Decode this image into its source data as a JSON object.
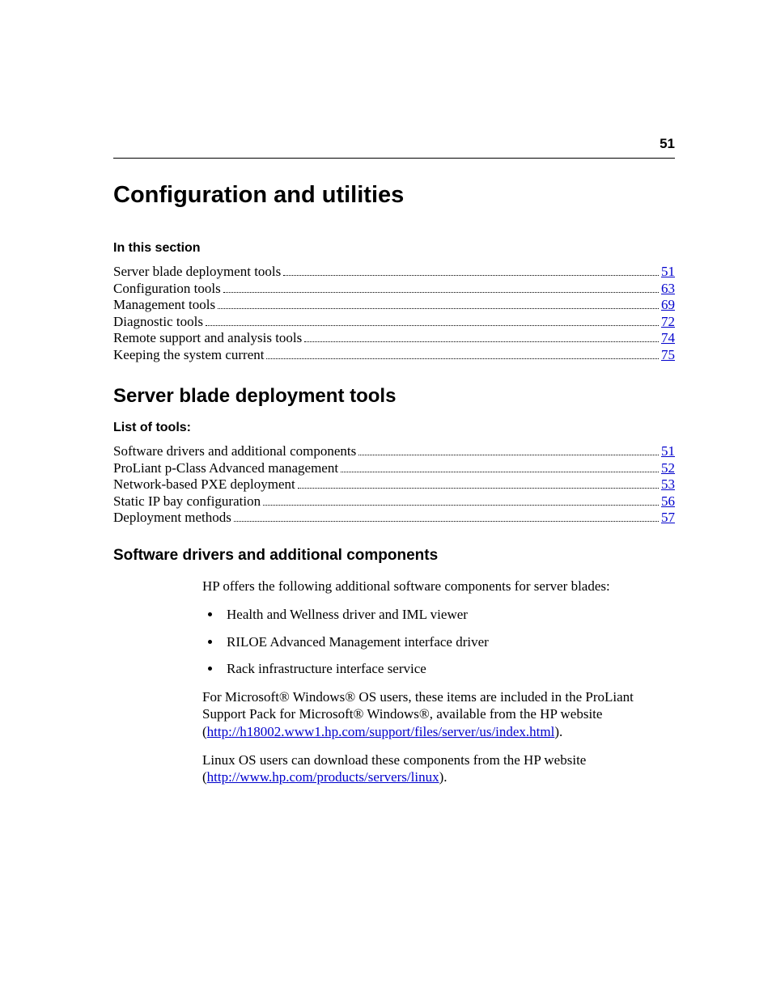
{
  "page_number": "51",
  "title": "Configuration and utilities",
  "section_label": "In this section",
  "toc1": [
    {
      "label": "Server blade deployment tools ",
      "page": "51"
    },
    {
      "label": "Configuration tools",
      "page": "63"
    },
    {
      "label": "Management tools ",
      "page": "69"
    },
    {
      "label": "Diagnostic tools",
      "page": "72"
    },
    {
      "label": "Remote support and analysis tools ",
      "page": "74"
    },
    {
      "label": "Keeping the system current ",
      "page": "75"
    }
  ],
  "h2": "Server blade deployment tools",
  "list_label": "List of tools:",
  "toc2": [
    {
      "label": "Software drivers and additional components",
      "page": "51"
    },
    {
      "label": "ProLiant p-Class Advanced management",
      "page": "52"
    },
    {
      "label": "Network-based PXE deployment ",
      "page": "53"
    },
    {
      "label": "Static IP bay configuration ",
      "page": "56"
    },
    {
      "label": "Deployment methods",
      "page": "57"
    }
  ],
  "h3": "Software drivers and additional components",
  "intro_para": "HP offers the following additional software components for server blades:",
  "bullets": [
    "Health and Wellness driver and IML viewer",
    "RILOE Advanced Management interface driver",
    "Rack infrastructure interface service"
  ],
  "para2_a": "For Microsoft® Windows® OS users, these items are included in the ProLiant Support Pack for Microsoft® Windows®, available from the HP website (",
  "para2_link": "http://h18002.www1.hp.com/support/files/server/us/index.html",
  "para2_b": ").",
  "para3_a": "Linux OS users can download these components from the HP website (",
  "para3_link": "http://www.hp.com/products/servers/linux",
  "para3_b": ")."
}
